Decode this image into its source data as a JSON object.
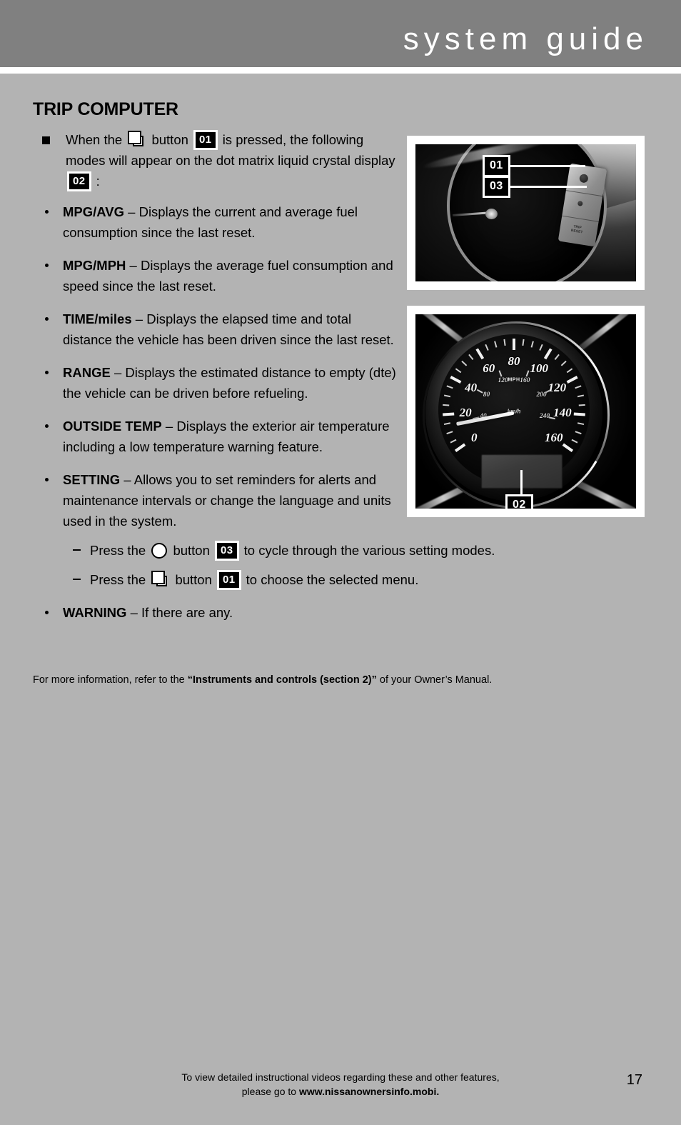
{
  "header": {
    "title": "system guide",
    "bar_color": "#808080",
    "title_color": "#ffffff"
  },
  "page_background": "#b3b3b3",
  "main": {
    "section_title": "TRIP COMPUTER",
    "intro": {
      "bullet": "square-bullet",
      "part1": "When the",
      "icon1": "double-square-button-icon",
      "part2": "button",
      "badge1": "01",
      "part3": "is pressed, the following modes will appear on the dot matrix liquid crystal display",
      "badge2": "02",
      "part4": ":"
    },
    "modes": [
      {
        "term": "MPG/AVG",
        "dash": "–",
        "desc": "Displays the current and average fuel consumption since the last reset."
      },
      {
        "term": "MPG/MPH",
        "dash": "–",
        "desc": "Displays the average fuel consumption and speed since the last reset."
      },
      {
        "term": "TIME/miles",
        "dash": "–",
        "desc": "Displays the elapsed time and total distance the vehicle has been driven since the last reset."
      },
      {
        "term": "RANGE",
        "dash": "–",
        "desc": "Displays the estimated distance to empty (dte) the vehicle can be driven before refueling."
      },
      {
        "term": "OUTSIDE TEMP",
        "dash": "–",
        "desc": "Displays the exterior air temperature including a low temperature warning feature."
      }
    ],
    "setting": {
      "term": "SETTING",
      "dash": "–",
      "desc": "Allows you to set reminders for alerts and maintenance intervals or change the language and units used in the system.",
      "subitems": [
        {
          "pre": "Press the",
          "icon": "circle-button-icon",
          "mid": "button",
          "badge": "03",
          "post": "to cycle through the various setting modes."
        },
        {
          "pre": "Press the",
          "icon": "double-square-button-icon",
          "mid": "button",
          "badge": "01",
          "post": "to choose the selected menu."
        }
      ]
    },
    "warning": {
      "term": "WARNING",
      "dash": "–",
      "desc": "If there are any."
    },
    "footnote": {
      "pre": "For more information, refer to the ",
      "bold": "“Instruments and controls (section 2)”",
      "post": " of your Owner’s Manual."
    }
  },
  "photos": {
    "top": {
      "alt_name": "instrument-cluster-and-steering-wheel-buttons-photo",
      "callouts": [
        {
          "label": "01"
        },
        {
          "label": "03"
        }
      ]
    },
    "bottom": {
      "alt_name": "speedometer-with-lcd-display-photo",
      "callouts": [
        {
          "label": "02"
        }
      ],
      "gauge": {
        "mph_unit": "MPH",
        "kmh_unit": "km/h",
        "mph_labels": [
          "0",
          "20",
          "40",
          "60",
          "80",
          "100",
          "120",
          "140",
          "160"
        ],
        "kmh_labels": [
          "40",
          "80",
          "120",
          "160",
          "200",
          "240"
        ]
      }
    }
  },
  "footer": {
    "line1": "To view detailed instructional videos regarding these and other features,",
    "line2_pre": "please go to ",
    "line2_bold": "www.nissanownersinfo.mobi.",
    "page_number": "17"
  }
}
